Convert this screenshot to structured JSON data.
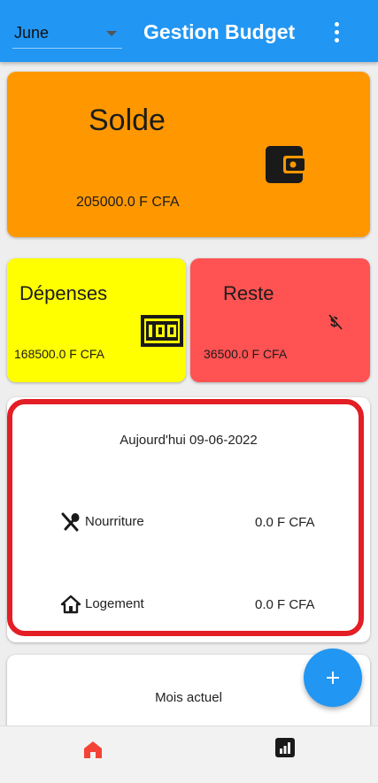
{
  "header": {
    "month_selected": "June",
    "title": "Gestion Budget",
    "menu_icon": "more-vert-icon"
  },
  "solde": {
    "title": "Solde",
    "amount": "205000.0 F CFA",
    "icon": "wallet-icon",
    "color": "#ff9800"
  },
  "depenses": {
    "title": "Dépenses",
    "amount": "168500.0 F CFA",
    "icon": "money-icon",
    "color": "#ffff00"
  },
  "reste": {
    "title": "Reste",
    "amount": "36500.0 F CFA",
    "icon": "money-off-icon",
    "color": "#ff5252"
  },
  "today": {
    "date_label": "Aujourd'hui 09-06-2022",
    "items": [
      {
        "label": "Nourriture",
        "value": "0.0 F CFA",
        "icon": "restaurant-icon"
      },
      {
        "label": "Logement",
        "value": "0.0 F CFA",
        "icon": "house-icon"
      }
    ]
  },
  "month_card": {
    "title": "Mois actuel"
  },
  "fab": {
    "icon": "add-icon"
  },
  "bottom_nav": {
    "items": [
      {
        "icon": "home-icon",
        "active": true,
        "color": "#f44336"
      },
      {
        "icon": "bar-chart-icon",
        "active": false
      }
    ]
  },
  "accent_color": "#2196f3",
  "highlight_color": "#e31e24"
}
